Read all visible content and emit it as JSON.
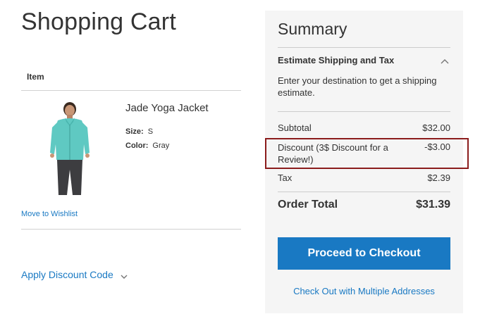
{
  "page": {
    "title": "Shopping Cart"
  },
  "cart": {
    "column_item": "Item",
    "product": {
      "name": "Jade Yoga Jacket",
      "options": [
        {
          "label": "Size:",
          "value": "S"
        },
        {
          "label": "Color:",
          "value": "Gray"
        }
      ],
      "image_icon": "product-photo",
      "wishlist_link": "Move to Wishlist"
    },
    "discount_toggle": "Apply Discount Code"
  },
  "summary": {
    "title": "Summary",
    "shipping_heading": "Estimate Shipping and Tax",
    "shipping_description": "Enter your destination to get a shipping estimate.",
    "subtotal": {
      "label": "Subtotal",
      "value": "$32.00"
    },
    "discount": {
      "label": "Discount (3$ Discount for a Review!)",
      "value": "-$3.00"
    },
    "tax": {
      "label": "Tax",
      "value": "$2.39"
    },
    "order_total": {
      "label": "Order Total",
      "value": "$31.39"
    },
    "checkout_button": "Proceed to Checkout",
    "multiple_addresses_link": "Check Out with Multiple Addresses"
  },
  "colors": {
    "accent": "#1979c3",
    "summary_bg": "#f5f5f5",
    "highlight": "#8b1c1c"
  }
}
